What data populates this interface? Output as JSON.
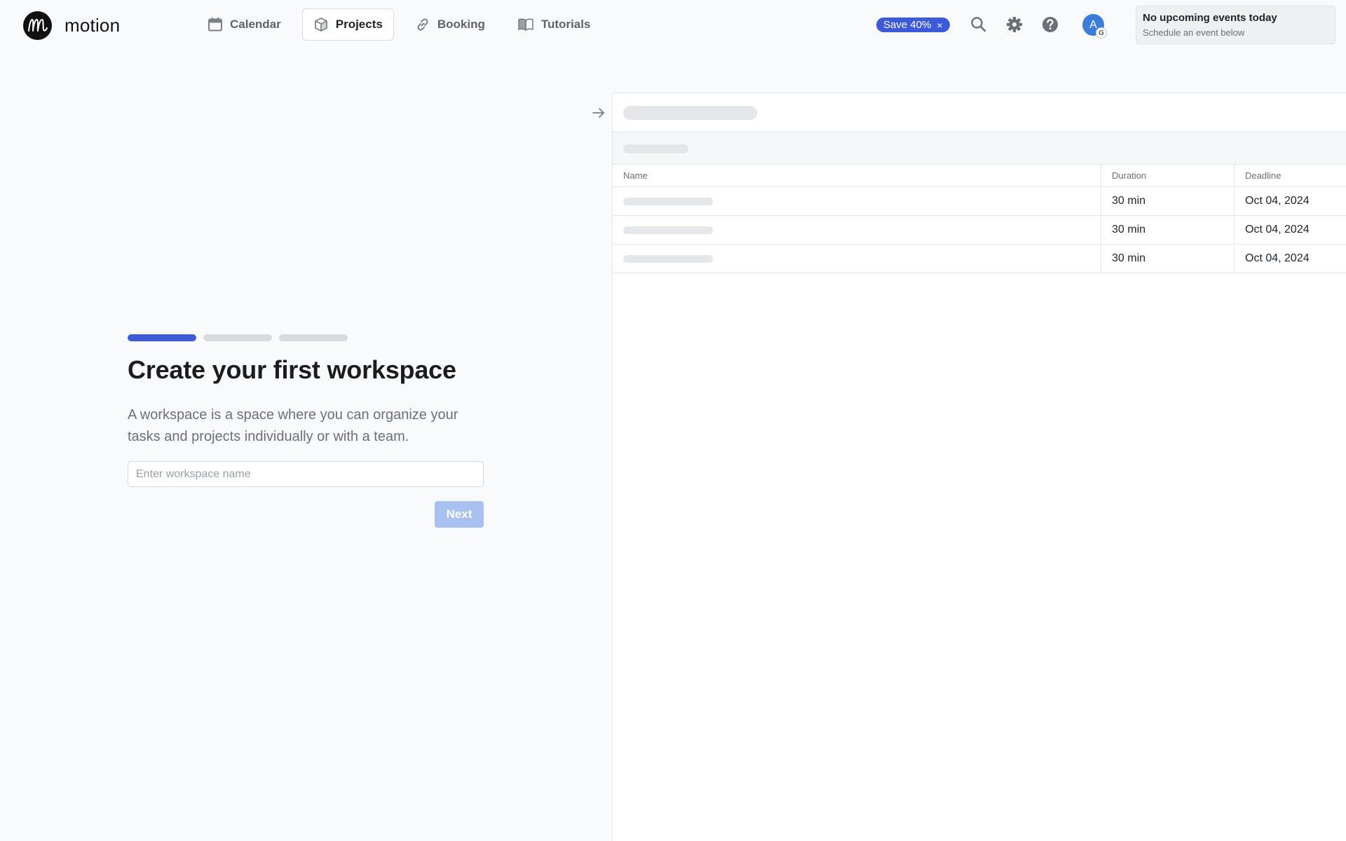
{
  "app": {
    "name": "motion"
  },
  "nav": {
    "tabs": [
      {
        "label": "Calendar",
        "icon": "calendar-icon",
        "active": false
      },
      {
        "label": "Projects",
        "icon": "cube-icon",
        "active": true
      },
      {
        "label": "Booking",
        "icon": "link-icon",
        "active": false
      },
      {
        "label": "Tutorials",
        "icon": "book-icon",
        "active": false
      }
    ]
  },
  "promo": {
    "label": "Save 40%",
    "close": "×"
  },
  "header_icons": [
    "search-icon",
    "gear-icon",
    "help-icon"
  ],
  "avatar": {
    "initial": "A",
    "badge": "G"
  },
  "events": {
    "title": "No upcoming events today",
    "subtitle": "Schedule an event below"
  },
  "onboarding": {
    "steps_total": 3,
    "current_step": 1,
    "title": "Create your first workspace",
    "description": "A workspace is a space where you can organize your tasks and projects individually or with a team.",
    "input_placeholder": "Enter workspace name",
    "input_value": "",
    "next_label": "Next"
  },
  "preview": {
    "columns": [
      "Name",
      "Duration",
      "Deadline"
    ],
    "rows": [
      {
        "duration": "30 min",
        "deadline": "Oct 04, 2024"
      },
      {
        "duration": "30 min",
        "deadline": "Oct 04, 2024"
      },
      {
        "duration": "30 min",
        "deadline": "Oct 04, 2024"
      }
    ]
  },
  "colors": {
    "accent": "#3d5bd9",
    "next_disabled": "#a9c1f0",
    "background": "#f9fafb",
    "avatar": "#3b7dd8"
  }
}
